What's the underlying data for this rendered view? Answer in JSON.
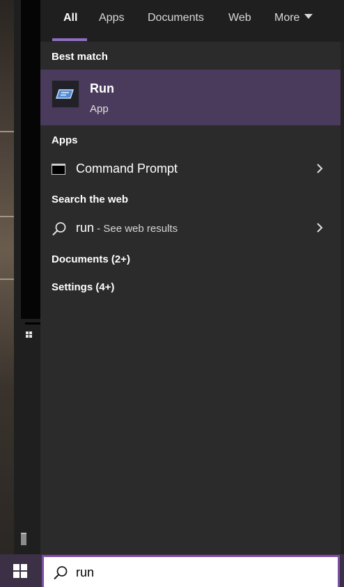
{
  "tabs": [
    {
      "label": "All",
      "active": true
    },
    {
      "label": "Apps",
      "active": false
    },
    {
      "label": "Documents",
      "active": false
    },
    {
      "label": "Web",
      "active": false
    },
    {
      "label": "More",
      "active": false
    }
  ],
  "sections": {
    "best_match": "Best match",
    "apps": "Apps",
    "search_web": "Search the web",
    "documents": "Documents (2+)",
    "settings": "Settings (4+)"
  },
  "best_match": {
    "title": "Run",
    "subtitle": "App",
    "icon": "run-app-icon"
  },
  "apps": [
    {
      "label": "Command Prompt",
      "icon": "command-prompt-icon"
    }
  ],
  "web_result": {
    "query": "run",
    "suffix": " - See web results",
    "icon": "search-icon"
  },
  "search": {
    "value": "run"
  },
  "colors": {
    "accent": "#8f6ec0",
    "selected_bg": "#4a3a5c",
    "panel_bg": "#2b2b2b",
    "taskbar_bg": "#3b3045"
  }
}
